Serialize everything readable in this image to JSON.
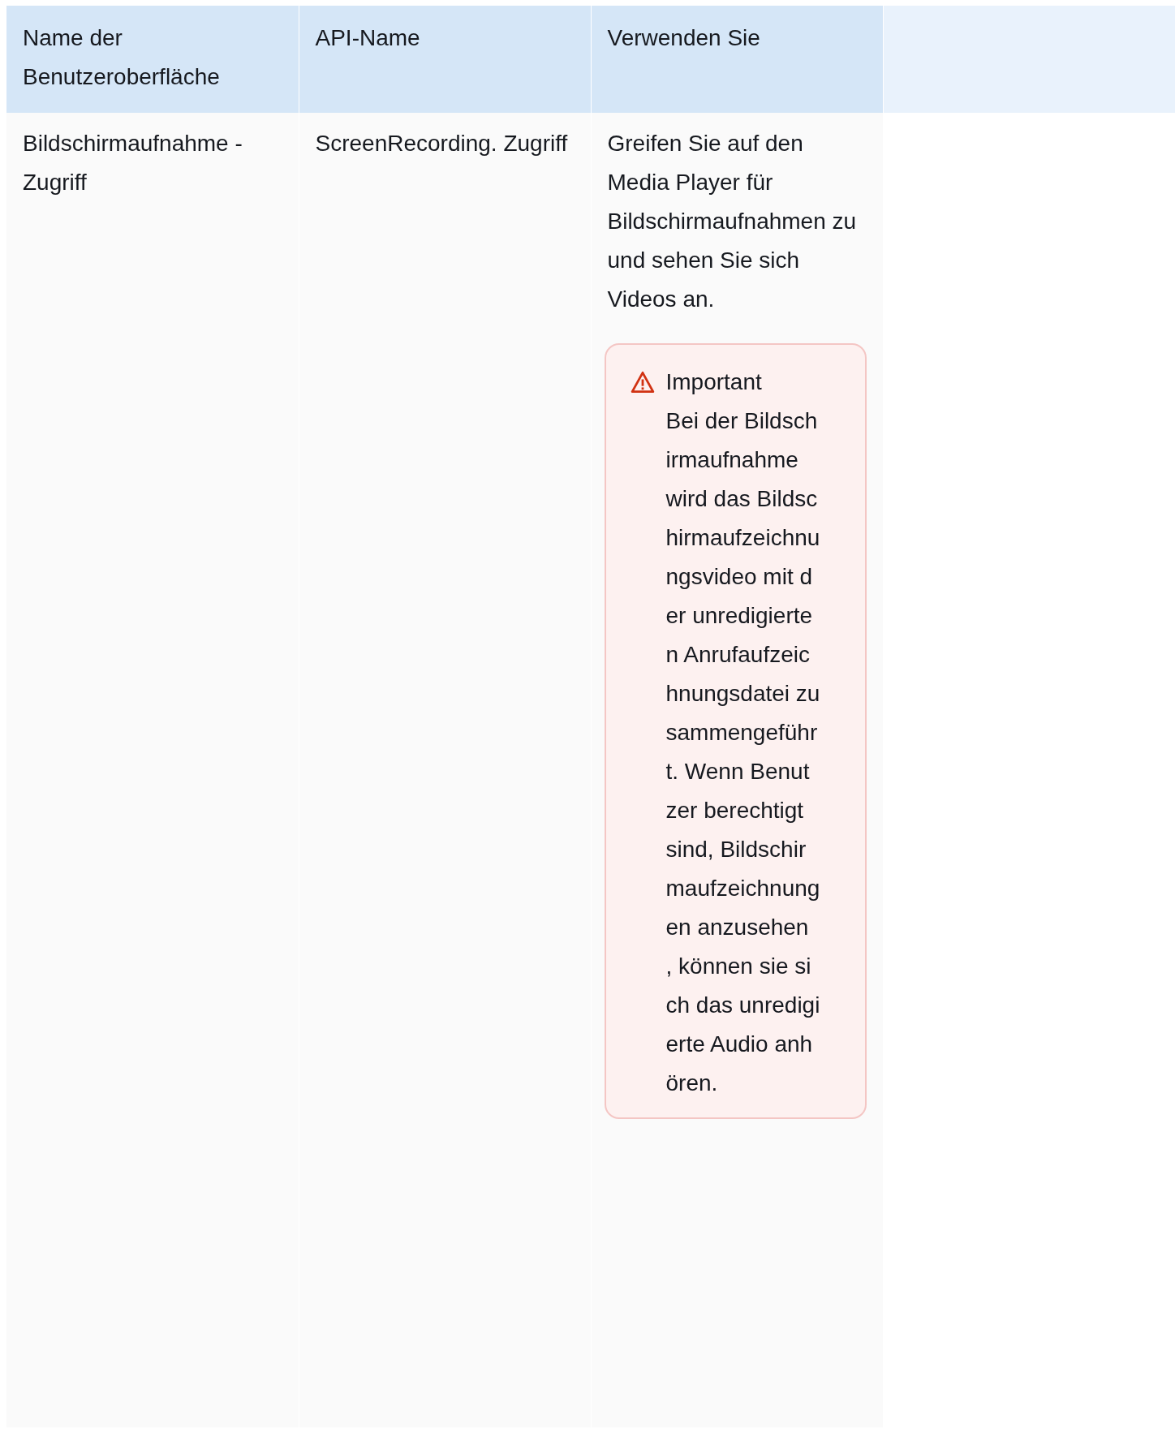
{
  "table": {
    "columns": [
      "Name der Benutzeroberfläche",
      "API-Name",
      "Verwenden Sie"
    ],
    "rows": [
      {
        "ui_name": "Bildschirmaufnahme - Zugriff",
        "api_name": "ScreenRecording. Zugriff",
        "use": "Greifen Sie auf den Media Player für Bildschirmaufnahmen zu und sehen Sie sich Videos an.",
        "alert": {
          "kind": "warning",
          "title": "Important",
          "text": "Bei der Bildschirmaufnahme wird das Bildschirmaufzeichnungsvideo mit der unredigierten Anrufaufzeichnungsdatei zusammengeführt. Wenn Benutzer berechtigt sind, Bildschirmaufzeichnungen anzusehen , können sie sich das unredigierte Audio anhören."
        }
      }
    ]
  }
}
